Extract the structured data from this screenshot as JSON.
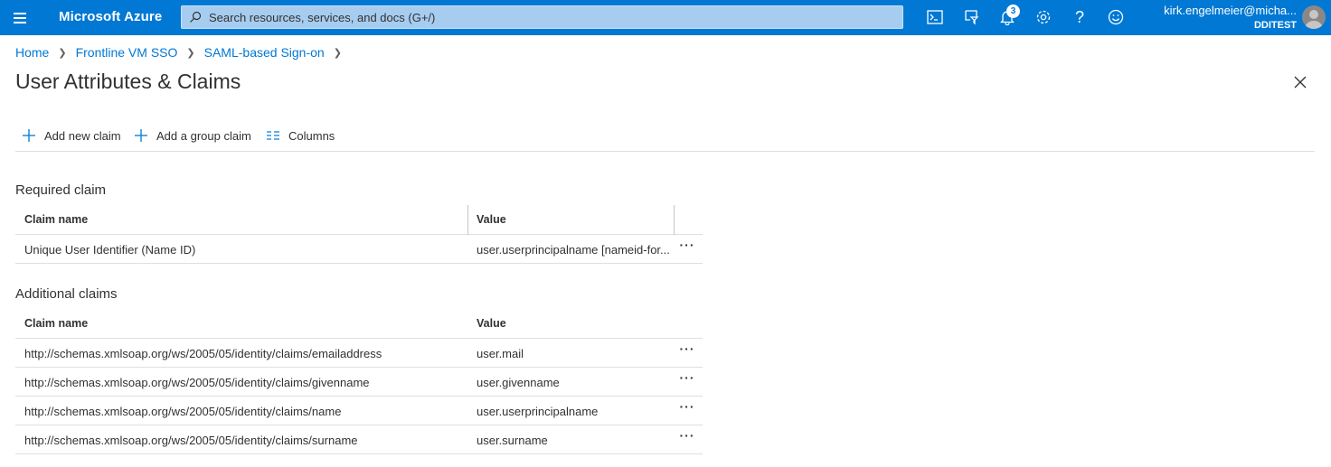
{
  "topbar": {
    "brand": "Microsoft Azure",
    "search_placeholder": "Search resources, services, and docs (G+/)",
    "notifications_count": "3",
    "user_email": "kirk.engelmeier@micha...",
    "user_tenant": "DDITEST",
    "icons": [
      "hamburger-icon",
      "cloud-shell-icon",
      "directory-filter-icon",
      "notifications-icon",
      "settings-icon",
      "help-icon",
      "feedback-icon",
      "avatar"
    ]
  },
  "breadcrumb": {
    "items": [
      "Home",
      "Frontline VM SSO",
      "SAML-based Sign-on"
    ]
  },
  "page": {
    "title": "User Attributes & Claims"
  },
  "toolbar": {
    "add_new_claim": "Add new claim",
    "add_group_claim": "Add a group claim",
    "columns": "Columns"
  },
  "required": {
    "section_title": "Required claim",
    "header_name": "Claim name",
    "header_value": "Value",
    "rows": [
      {
        "name": "Unique User Identifier (Name ID)",
        "value": "user.userprincipalname [nameid-for..."
      }
    ]
  },
  "additional": {
    "section_title": "Additional claims",
    "header_name": "Claim name",
    "header_value": "Value",
    "rows": [
      {
        "name": "http://schemas.xmlsoap.org/ws/2005/05/identity/claims/emailaddress",
        "value": "user.mail"
      },
      {
        "name": "http://schemas.xmlsoap.org/ws/2005/05/identity/claims/givenname",
        "value": "user.givenname"
      },
      {
        "name": "http://schemas.xmlsoap.org/ws/2005/05/identity/claims/name",
        "value": "user.userprincipalname"
      },
      {
        "name": "http://schemas.xmlsoap.org/ws/2005/05/identity/claims/surname",
        "value": "user.surname"
      }
    ]
  },
  "colors": {
    "accent": "#0078d4",
    "text": "#323130",
    "divider": "#e1dfdd"
  }
}
